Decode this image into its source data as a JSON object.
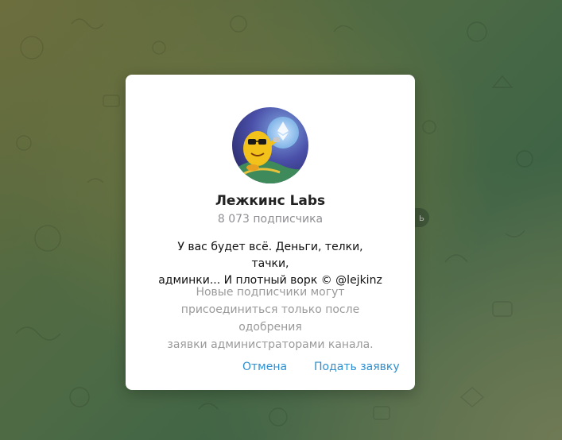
{
  "background": {
    "edge_text": "ь"
  },
  "dialog": {
    "avatar_icon": "channel-avatar-cartoon",
    "channel_name": "Лежкинс Labs",
    "subscribers": "8 073 подписчика",
    "description_line1": "У вас будет всё. Деньги, телки, тачки,",
    "description_line2": "админки... И плотный ворк © @lejkinz",
    "notice_line1": "Новые подписчики могут",
    "notice_line2": "присоединиться только после одобрения",
    "notice_line3": "заявки администраторами канала.",
    "cancel_label": "Отмена",
    "apply_label": "Подать заявку"
  },
  "colors": {
    "accent": "#2f8fcf",
    "muted_text": "#9a9a9a",
    "dialog_bg": "#ffffff"
  }
}
